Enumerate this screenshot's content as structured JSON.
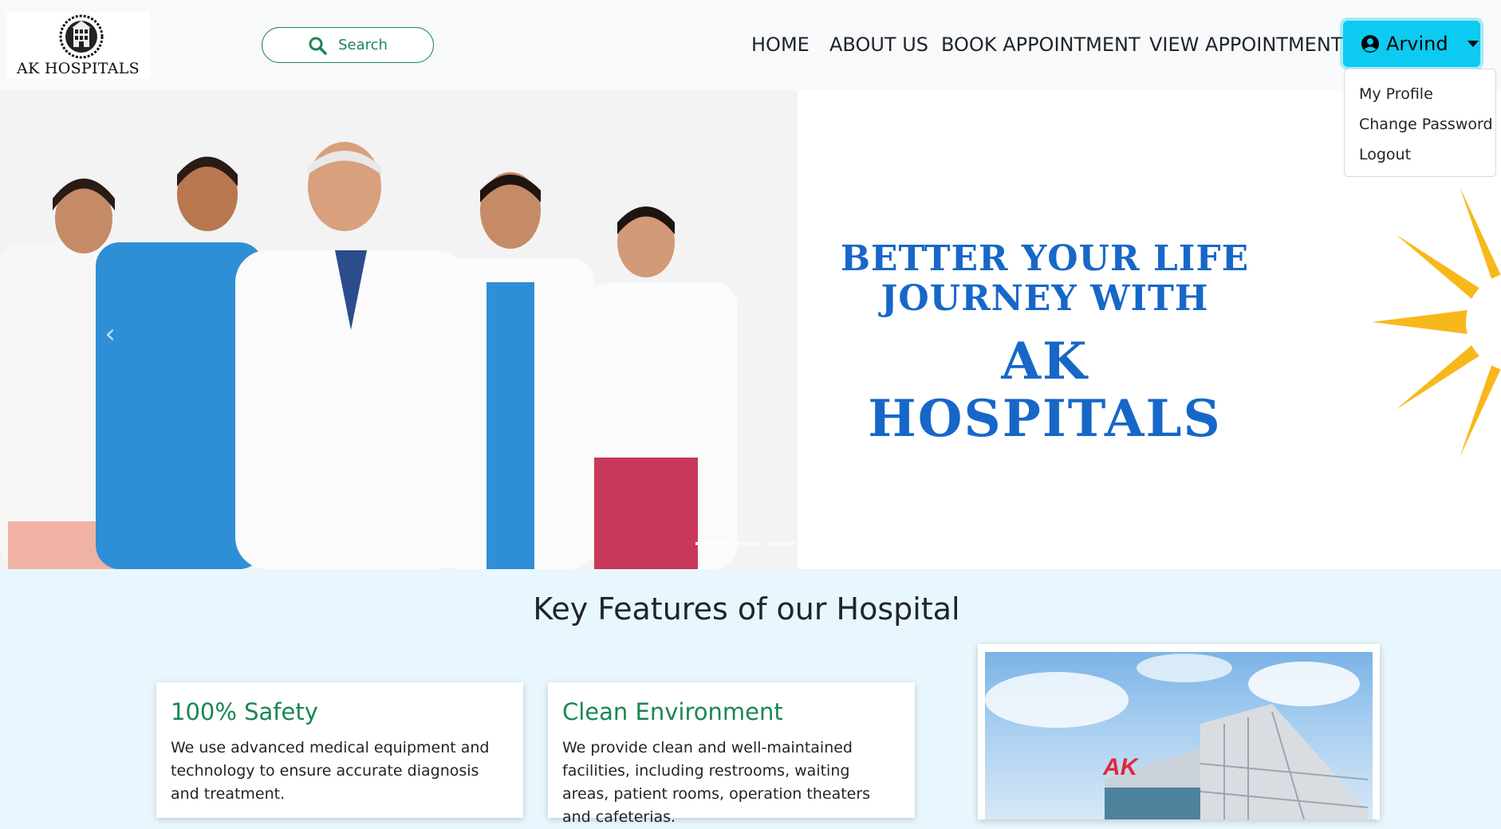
{
  "navbar": {
    "logo_text": "AK HOSPITALS",
    "search_label": "Search",
    "links": [
      "HOME",
      "ABOUT US",
      "BOOK APPOINTMENT",
      "VIEW APPOINTMENT"
    ],
    "user": {
      "name": "Arvind",
      "menu": [
        "My Profile",
        "Change Password",
        "Logout"
      ]
    }
  },
  "hero": {
    "line1": "BETTER YOUR LIFE",
    "line2": "JOURNEY WITH",
    "line3": "AK",
    "line4": "HOSPITALS",
    "slide_count": 3,
    "active_slide": 1
  },
  "features": {
    "title": "Key Features of our Hospital",
    "cards": [
      {
        "title": "100% Safety",
        "text": "We use advanced medical equipment and technology to ensure accurate diagnosis and treatment."
      },
      {
        "title": "Clean Environment",
        "text": "We provide clean and well-maintained facilities, including restrooms, waiting areas, patient rooms, operation theaters and cafeterias."
      }
    ],
    "building_sign": "AK"
  },
  "colors": {
    "accent_green": "#198754",
    "user_button": "#0dcaf0",
    "hero_blue": "#1767c8",
    "sun_yellow": "#f7b81b",
    "section_bg": "#e8f7fd"
  },
  "icons": {
    "search": "search-icon",
    "user": "user-circle-icon",
    "caret": "caret-down-icon"
  }
}
